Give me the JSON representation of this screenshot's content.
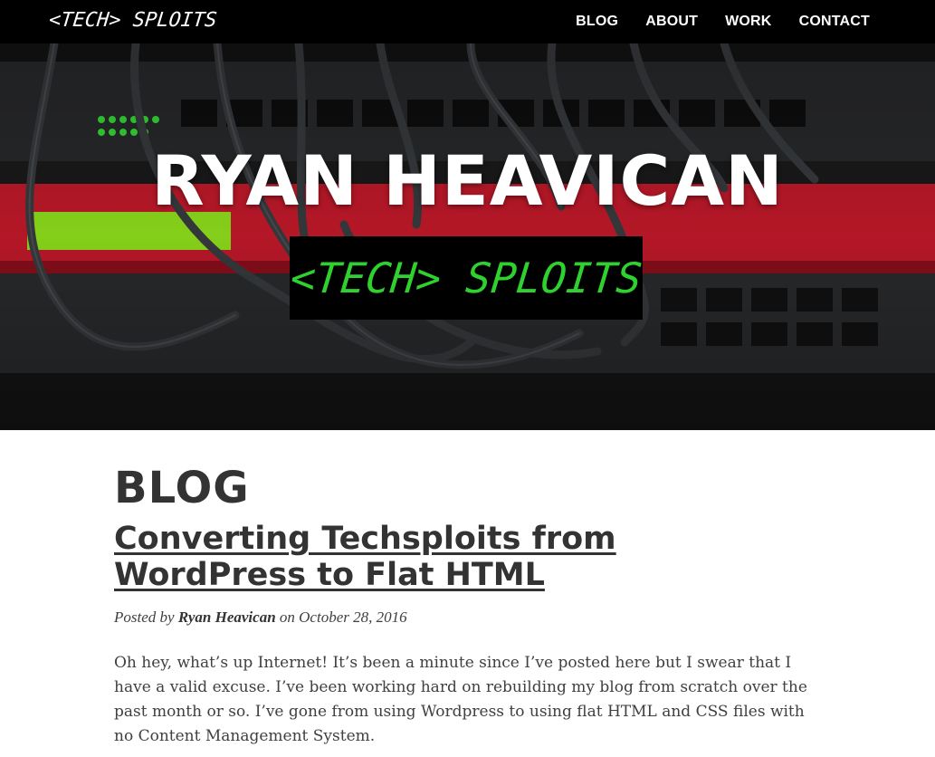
{
  "navbar": {
    "brand": "<TECH> SPLOITS",
    "links": [
      "BLOG",
      "ABOUT",
      "WORK",
      "CONTACT"
    ]
  },
  "hero": {
    "title": "RYAN HEAVICAN",
    "badge": "<TECH> SPLOITS",
    "image_colors": {
      "background": "#1b1b1c",
      "device_red": "#c81a2b",
      "lcd_green": "#93e61d",
      "led_green": "#39e639"
    }
  },
  "content": {
    "heading": "BLOG",
    "post": {
      "title": "Converting Techsploits from WordPress to Flat HTML",
      "meta_prefix": "Posted by",
      "author": "Ryan Heavican",
      "meta_on": "on",
      "date": "October 28, 2016",
      "excerpt": "Oh hey, what’s up Internet! It’s been a minute since I’ve posted here but I swear that I have a valid excuse. I’ve been working hard on rebuilding my blog from scratch over the past month or so. I’ve gone from using Wordpress to using flat HTML and CSS files with no Content Management System."
    }
  },
  "colors": {
    "navbar_bg": "#000000",
    "text_dark": "#333333",
    "text_body": "#404040",
    "badge_text": "#2fd12f"
  }
}
